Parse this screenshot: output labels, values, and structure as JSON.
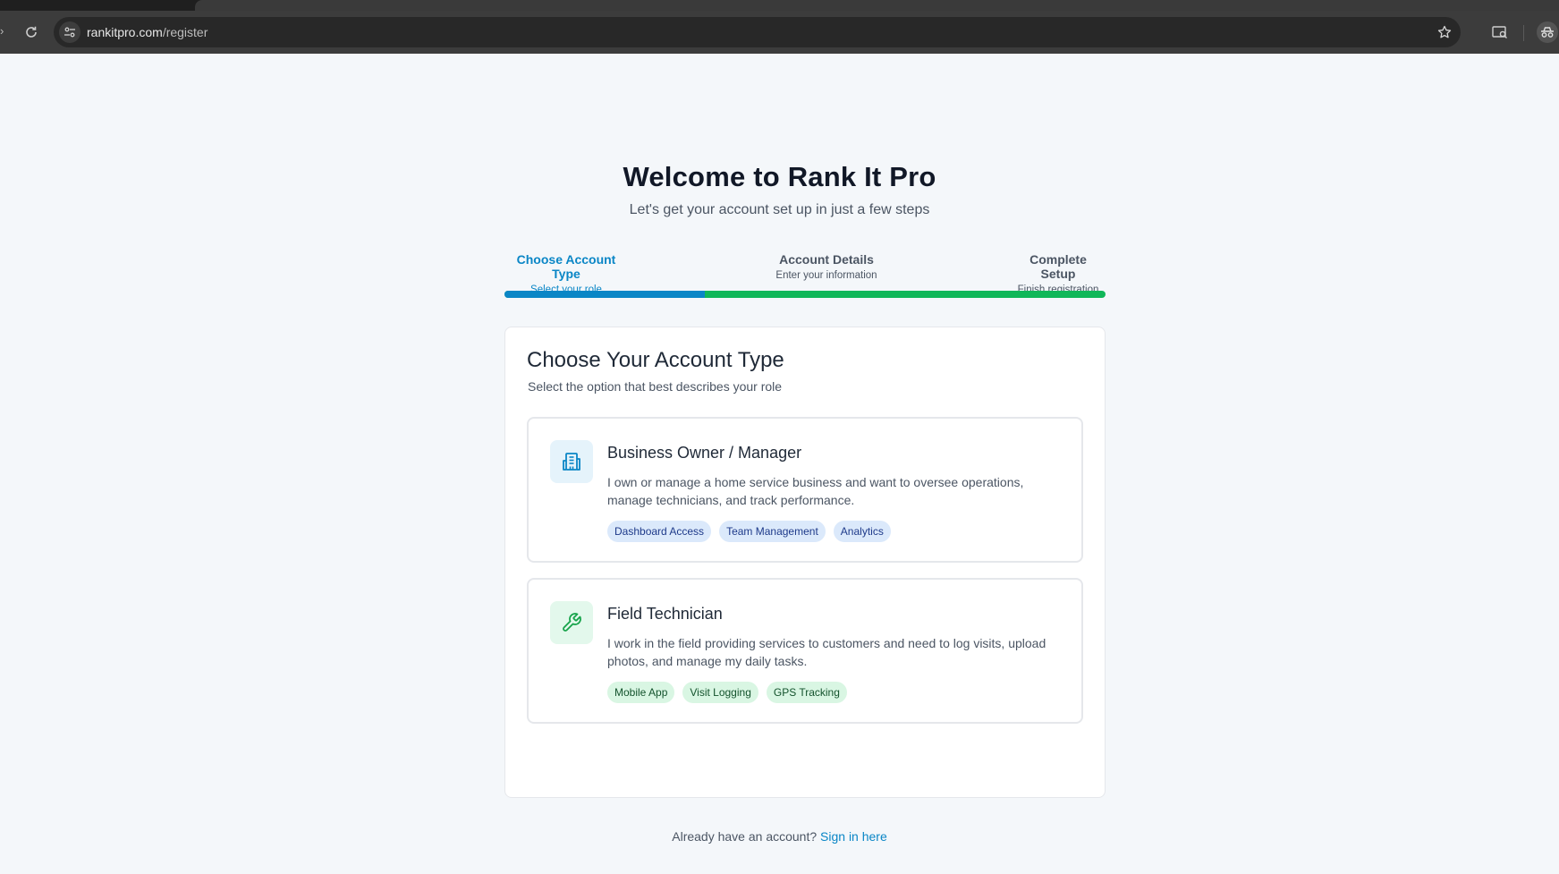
{
  "browser": {
    "url_host": "rankitpro.com",
    "url_path": "/register"
  },
  "header": {
    "title": "Welcome to Rank It Pro",
    "subtitle": "Let's get your account set up in just a few steps"
  },
  "steps": [
    {
      "label": "Choose Account Type",
      "desc": "Select your role",
      "active": true
    },
    {
      "label": "Account Details",
      "desc": "Enter your information",
      "active": false
    },
    {
      "label": "Complete Setup",
      "desc": "Finish registration",
      "active": false
    }
  ],
  "progress": {
    "fraction": 0.333
  },
  "card": {
    "title": "Choose Your Account Type",
    "subtitle": "Select the option that best describes your role",
    "options": [
      {
        "icon": "building-icon",
        "title": "Business Owner / Manager",
        "desc": "I own or manage a home service business and want to oversee operations, manage technicians, and track performance.",
        "tags": [
          "Dashboard Access",
          "Team Management",
          "Analytics"
        ],
        "color": "#0a86c6"
      },
      {
        "icon": "wrench-icon",
        "title": "Field Technician",
        "desc": "I work in the field providing services to customers and need to log visits, upload photos, and manage my daily tasks.",
        "tags": [
          "Mobile App",
          "Visit Logging",
          "GPS Tracking"
        ],
        "color": "#16a34a"
      }
    ]
  },
  "footer": {
    "prompt": "Already have an account?",
    "link": "Sign in here"
  },
  "colors": {
    "accent": "#0a86c6",
    "success": "#10b759"
  }
}
